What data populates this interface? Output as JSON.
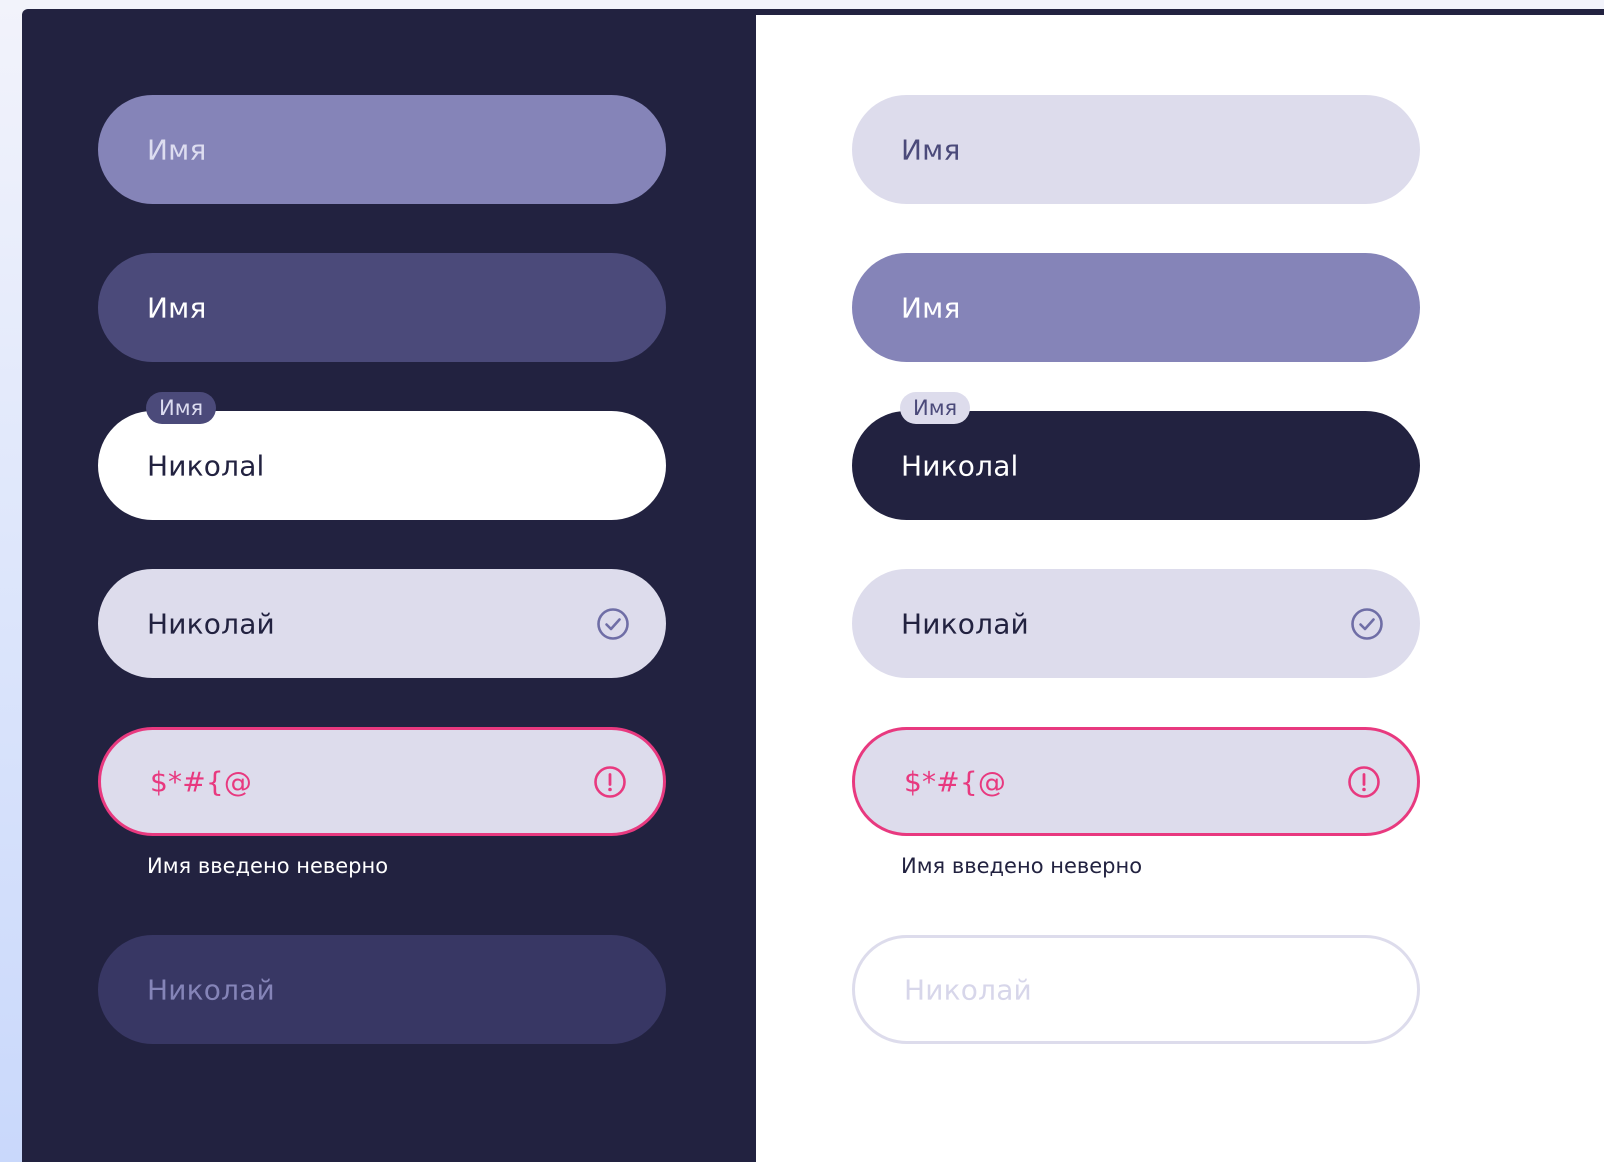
{
  "colors": {
    "dark_background": "#222240",
    "light_background": "#ffffff",
    "primary": "#222240",
    "violet": "#8584b8",
    "violet_dark": "#4b4a7a",
    "lavender": "#dddcec",
    "error": "#e8397f",
    "disabled_dark": "#383764"
  },
  "dark_panel": {
    "fields": [
      {
        "state": "placeholder",
        "text": "Имя"
      },
      {
        "state": "hover",
        "text": "Имя"
      },
      {
        "state": "focus",
        "label": "Имя",
        "text": "Николаl"
      },
      {
        "state": "success",
        "text": "Николай",
        "icon": "check-circle-icon"
      },
      {
        "state": "error",
        "text": "$*#{@",
        "icon": "alert-circle-icon",
        "hint": "Имя введено неверно"
      },
      {
        "state": "disabled",
        "text": "Николай"
      }
    ]
  },
  "light_panel": {
    "fields": [
      {
        "state": "placeholder",
        "text": "Имя"
      },
      {
        "state": "hover",
        "text": "Имя"
      },
      {
        "state": "focus",
        "label": "Имя",
        "text": "Николаl"
      },
      {
        "state": "success",
        "text": "Николай",
        "icon": "check-circle-icon"
      },
      {
        "state": "error",
        "text": "$*#{@",
        "icon": "alert-circle-icon",
        "hint": "Имя введено неверно"
      },
      {
        "state": "disabled",
        "text": "Николай"
      }
    ]
  }
}
